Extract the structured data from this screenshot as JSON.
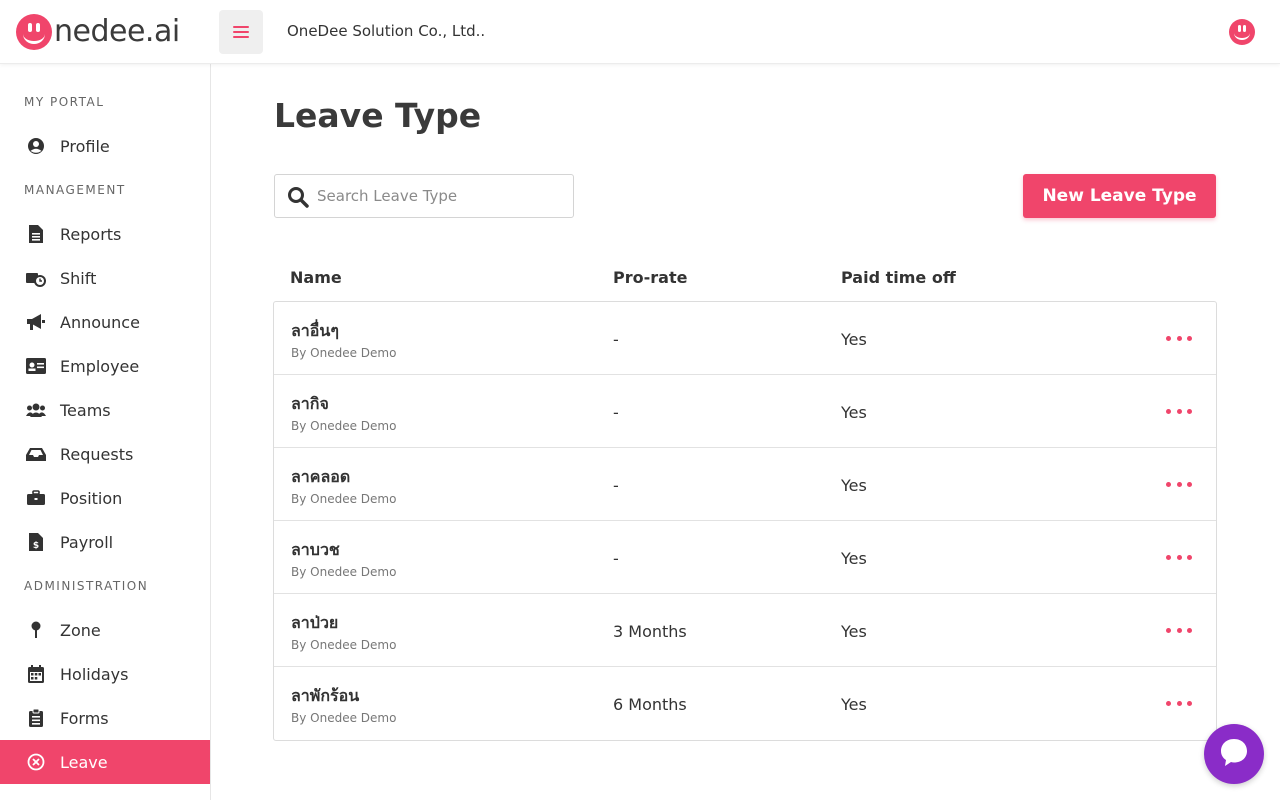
{
  "brand": {
    "logo_text": "nedee.ai",
    "accent": "#f0456b"
  },
  "header": {
    "company": "OneDee Solution Co., Ltd.."
  },
  "sidebar": {
    "sections": [
      {
        "title": "MY PORTAL"
      },
      {
        "title": "MANAGEMENT"
      },
      {
        "title": "ADMINISTRATION"
      }
    ],
    "items": [
      {
        "label": "Profile",
        "icon": "user-circle-icon"
      },
      {
        "label": "Reports",
        "icon": "file-icon"
      },
      {
        "label": "Shift",
        "icon": "clock-shift-icon"
      },
      {
        "label": "Announce",
        "icon": "megaphone-icon"
      },
      {
        "label": "Employee",
        "icon": "id-card-icon"
      },
      {
        "label": "Teams",
        "icon": "users-icon"
      },
      {
        "label": "Requests",
        "icon": "inbox-icon"
      },
      {
        "label": "Position",
        "icon": "briefcase-icon"
      },
      {
        "label": "Payroll",
        "icon": "invoice-dollar-icon"
      },
      {
        "label": "Zone",
        "icon": "map-pin-icon"
      },
      {
        "label": "Holidays",
        "icon": "calendar-icon"
      },
      {
        "label": "Forms",
        "icon": "clipboard-icon"
      },
      {
        "label": "Leave",
        "icon": "times-circle-icon",
        "active": true
      }
    ]
  },
  "main": {
    "title": "Leave Type",
    "search_placeholder": "Search Leave Type",
    "new_button": "New Leave Type",
    "columns": [
      "Name",
      "Pro-rate",
      "Paid time off"
    ],
    "rows": [
      {
        "name": "ลาอื่นๆ",
        "by": "By Onedee Demo",
        "prorate": "-",
        "paid": "Yes"
      },
      {
        "name": "ลากิจ",
        "by": "By Onedee Demo",
        "prorate": "-",
        "paid": "Yes"
      },
      {
        "name": "ลาคลอด",
        "by": "By Onedee Demo",
        "prorate": "-",
        "paid": "Yes"
      },
      {
        "name": "ลาบวช",
        "by": "By Onedee Demo",
        "prorate": "-",
        "paid": "Yes"
      },
      {
        "name": "ลาป่วย",
        "by": "By Onedee Demo",
        "prorate": "3 Months",
        "paid": "Yes"
      },
      {
        "name": "ลาพักร้อน",
        "by": "By Onedee Demo",
        "prorate": "6 Months",
        "paid": "Yes"
      }
    ]
  }
}
